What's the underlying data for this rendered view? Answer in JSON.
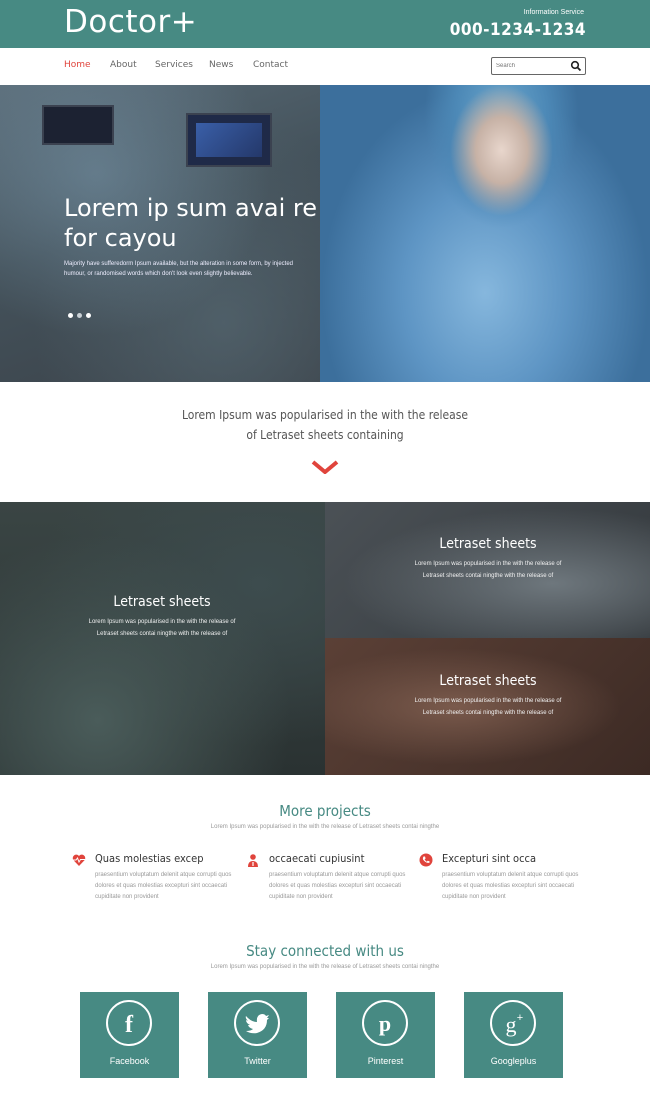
{
  "header": {
    "logo": "Doctor+",
    "info_label": "Information Service",
    "phone": "000-1234-1234"
  },
  "nav": {
    "items": [
      {
        "label": "Home",
        "active": true
      },
      {
        "label": "About",
        "active": false
      },
      {
        "label": "Services",
        "active": false
      },
      {
        "label": "News",
        "active": false
      },
      {
        "label": "Contact",
        "active": false
      }
    ],
    "search_placeholder": "Search",
    "search_icon": "search-icon"
  },
  "hero": {
    "title": "Lorem ip sum avai re for cayou",
    "subtitle": "Majority have sufferedorm Ipsum available, but the alteration in some form, by injected humour, or randomised words which don't look even slightly believable.",
    "slides": 3,
    "active_slide": 1
  },
  "intro": {
    "line1": "Lorem Ipsum was popularised in the with the release",
    "line2": "of Letraset sheets containing",
    "accent_color": "#e0443c"
  },
  "grid": {
    "tiles": [
      {
        "title": "Letraset sheets",
        "text": "Lorem Ipsum was popularised in the with the release of Letraset sheets contai ningthe with the release of"
      },
      {
        "title": "Letraset sheets",
        "text": "Lorem Ipsum was popularised in the with the release of Letraset sheets contai ningthe with the release of"
      },
      {
        "title": "Letraset sheets",
        "text": "Lorem Ipsum was popularised in the with the release of Letraset sheets contai ningthe with the release of"
      }
    ]
  },
  "projects": {
    "title": "More projects",
    "subtitle": "Lorem Ipsum was popularised in the with the release of Letraset sheets contai ningthe",
    "features": [
      {
        "icon": "heart-pulse-icon",
        "title": "Quas molestias excep",
        "text": "praesentium voluptatum delenit atque corrupti quos dolores et quas molestias excepturi sint occaecati cupiditate non provident"
      },
      {
        "icon": "doctor-icon",
        "title": "occaecati cupiusint",
        "text": "praesentium voluptatum delenit atque corrupti quos dolores et quas molestias excepturi sint occaecati cupiditate non provident"
      },
      {
        "icon": "phone-icon",
        "title": "Excepturi sint occa",
        "text": "praesentium voluptatum delenit atque corrupti quos dolores et quas molestias excepturi sint occaecati cupiditate non provident"
      }
    ]
  },
  "social": {
    "title": "Stay connected with us",
    "subtitle": "Lorem Ipsum was popularised in the with the release of Letraset sheets contai ningthe",
    "items": [
      {
        "label": "Facebook",
        "icon": "facebook-icon"
      },
      {
        "label": "Twitter",
        "icon": "twitter-icon"
      },
      {
        "label": "Pinterest",
        "icon": "pinterest-icon"
      },
      {
        "label": "Googleplus",
        "icon": "googleplus-icon"
      }
    ]
  },
  "colors": {
    "brand": "#478a83",
    "accent": "#e0443c"
  }
}
